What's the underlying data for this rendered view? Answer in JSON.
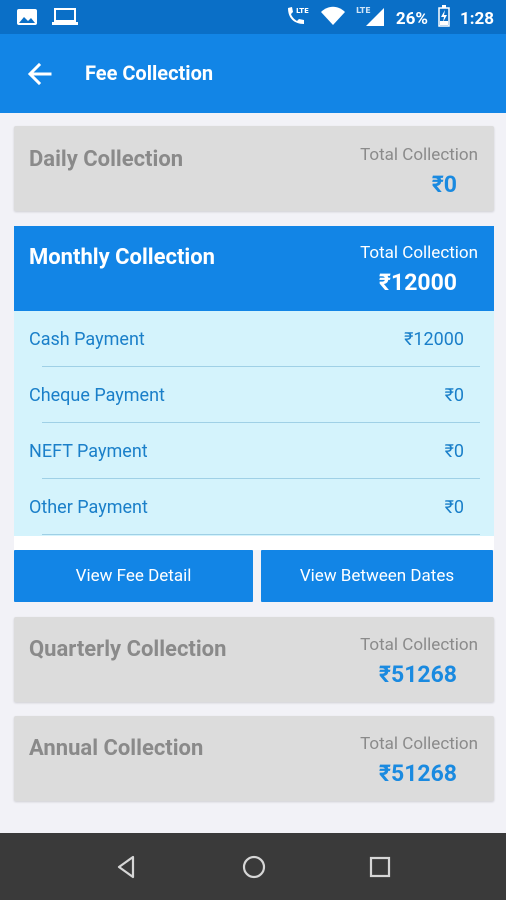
{
  "status_bar": {
    "battery": "26%",
    "time": "1:28",
    "network_1": "LTE",
    "network_2": "LTE"
  },
  "app_bar": {
    "title": "Fee Collection"
  },
  "cards": {
    "daily": {
      "name": "Daily Collection",
      "total_label": "Total Collection",
      "amount": "₹0"
    },
    "monthly": {
      "name": "Monthly Collection",
      "total_label": "Total Collection",
      "amount": "₹12000"
    },
    "quarterly": {
      "name": "Quarterly Collection",
      "total_label": "Total Collection",
      "amount": "₹51268"
    },
    "annual": {
      "name": "Annual Collection",
      "total_label": "Total Collection",
      "amount": "₹51268"
    }
  },
  "breakdown": [
    {
      "label": "Cash Payment",
      "value": "₹12000"
    },
    {
      "label": "Cheque Payment",
      "value": "₹0"
    },
    {
      "label": "NEFT Payment",
      "value": "₹0"
    },
    {
      "label": "Other Payment",
      "value": "₹0"
    }
  ],
  "buttons": {
    "view_fee_detail": "View Fee Detail",
    "view_between_dates": "View Between Dates"
  },
  "colors": {
    "primary": "#1285e6",
    "status_bar": "#0a6fc7",
    "accent_text": "#1a8ae0",
    "breakdown_bg": "#d4f3fc"
  }
}
